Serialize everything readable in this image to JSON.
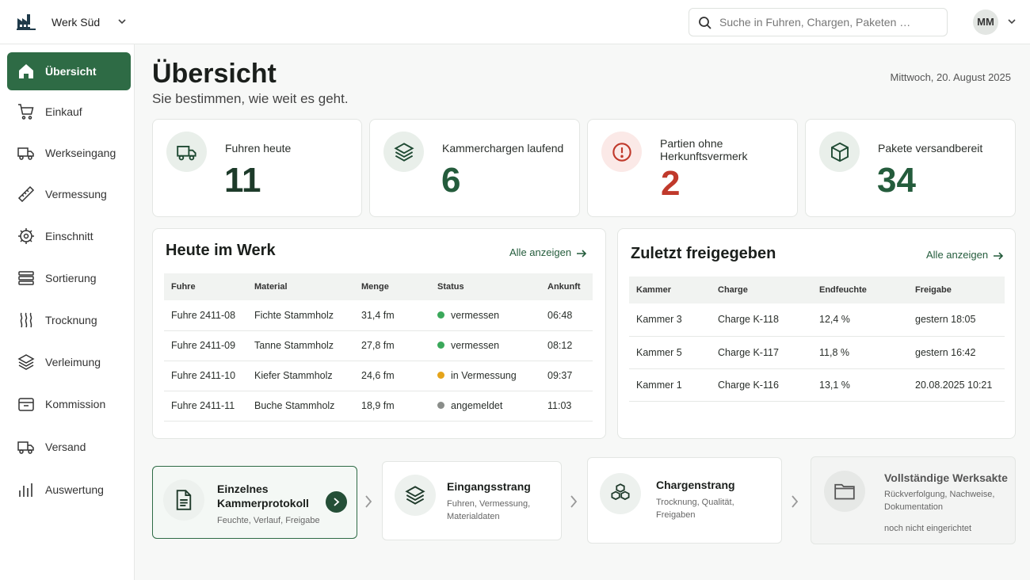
{
  "header": {
    "plant_name": "Werk Süd",
    "search_placeholder": "Suche in Fuhren, Chargen, Paketen …",
    "user_initials": "MM"
  },
  "sidebar": {
    "items": [
      {
        "label": "Übersicht",
        "icon": "home-icon",
        "active": true
      },
      {
        "label": "Einkauf",
        "icon": "cart-icon"
      },
      {
        "label": "Werkseingang",
        "icon": "truck-icon"
      },
      {
        "label": "Vermessung",
        "icon": "ruler-icon"
      },
      {
        "label": "Einschnitt",
        "icon": "saw-blade-icon"
      },
      {
        "label": "Sortierung",
        "icon": "stack-icon"
      },
      {
        "label": "Trocknung",
        "icon": "heat-waves-icon"
      },
      {
        "label": "Verleimung",
        "icon": "layers-icon"
      },
      {
        "label": "Kommission",
        "icon": "package-box-icon"
      },
      {
        "label": "Versand",
        "icon": "delivery-truck-icon"
      },
      {
        "label": "Auswertung",
        "icon": "bar-chart-icon"
      }
    ]
  },
  "page": {
    "title": "Übersicht",
    "subtitle": "Sie bestimmen, wie weit es geht.",
    "date": "Mittwoch, 20. August 2025"
  },
  "kpis": [
    {
      "label": "Fuhren heute",
      "value": "11",
      "icon": "truck-icon"
    },
    {
      "label": "Kammerchargen laufend",
      "value": "6",
      "icon": "layers-icon"
    },
    {
      "label": "Partien ohne Herkunftsvermerk",
      "value": "2",
      "icon": "alert-circle-icon"
    },
    {
      "label": "Pakete versandbereit",
      "value": "34",
      "icon": "package-icon"
    }
  ],
  "today": {
    "title": "Heute im Werk",
    "show_all": "Alle anzeigen",
    "columns": [
      "Fuhre",
      "Material",
      "Menge",
      "Status",
      "Ankunft"
    ],
    "rows": [
      {
        "fuhre": "Fuhre 2411-08",
        "material": "Fichte Stammholz",
        "menge": "31,4 fm",
        "status": "vermessen",
        "status_color": "#3aa85a",
        "ankunft": "06:48"
      },
      {
        "fuhre": "Fuhre 2411-09",
        "material": "Tanne Stammholz",
        "menge": "27,8 fm",
        "status": "vermessen",
        "status_color": "#3aa85a",
        "ankunft": "08:12"
      },
      {
        "fuhre": "Fuhre 2411-10",
        "material": "Kiefer Stammholz",
        "menge": "24,6 fm",
        "status": "in Vermessung",
        "status_color": "#e5a41a",
        "ankunft": "09:37"
      },
      {
        "fuhre": "Fuhre 2411-11",
        "material": "Buche Stammholz",
        "menge": "18,9 fm",
        "status": "angemeldet",
        "status_color": "#8a8d8a",
        "ankunft": "11:03"
      }
    ]
  },
  "released": {
    "title": "Zuletzt freigegeben",
    "show_all": "Alle anzeigen",
    "columns": [
      "Kammer",
      "Charge",
      "Endfeuchte",
      "Freigabe"
    ],
    "rows": [
      {
        "kammer": "Kammer 3",
        "charge": "Charge K-118",
        "feuchte": "12,4 %",
        "freigabe": "gestern 18:05"
      },
      {
        "kammer": "Kammer 5",
        "charge": "Charge K-117",
        "feuchte": "11,8 %",
        "freigabe": "gestern 16:42"
      },
      {
        "kammer": "Kammer 1",
        "charge": "Charge K-116",
        "feuchte": "13,1 %",
        "freigabe": "20.08.2025 10:21"
      }
    ]
  },
  "flows": [
    {
      "title": "Einzelnes Kammerprotokoll",
      "desc": "Feuchte, Verlauf, Freigabe",
      "icon": "document-icon",
      "selected": true
    },
    {
      "title": "Eingangsstrang",
      "desc": "Fuhren, Vermessung, Materialdaten",
      "icon": "layers-icon"
    },
    {
      "title": "Chargenstrang",
      "desc": "Trocknung, Qualität, Freigaben",
      "icon": "boxes-icon"
    },
    {
      "title": "Vollständige Werksakte",
      "desc": "Rückverfolgung, Nachweise, Dokumentation",
      "note": "noch nicht eingerichtet",
      "icon": "folder-icon",
      "disabled": true
    }
  ]
}
